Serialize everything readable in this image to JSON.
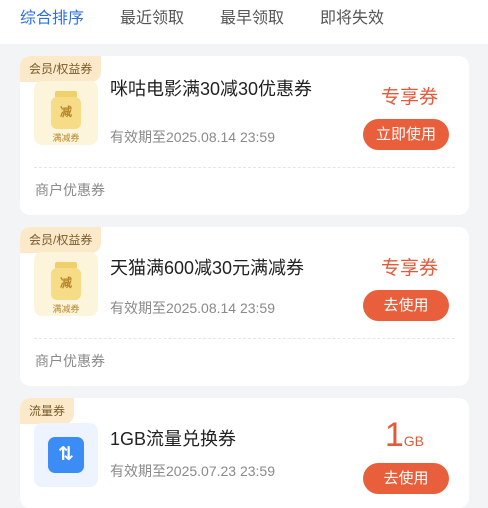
{
  "tabs": [
    {
      "label": "综合排序",
      "active": true
    },
    {
      "label": "最近领取",
      "active": false
    },
    {
      "label": "最早领取",
      "active": false
    },
    {
      "label": "即将失效",
      "active": false
    }
  ],
  "colors": {
    "accent": "#2f6fe0",
    "coupon_red": "#e4593a",
    "button": "#ea5f3b",
    "tag_bg": "#fbe9c9"
  },
  "coupons": [
    {
      "tag": "会员/权益券",
      "thumb_icon": "jar-icon",
      "thumb_symbol": "减",
      "thumb_caption": "满减券",
      "title": "咪咕电影满30减30优惠券",
      "validity": "有效期至2025.08.14 23:59",
      "badge": "专享券",
      "button": "立即使用",
      "merchant": "商户优惠券"
    },
    {
      "tag": "会员/权益券",
      "thumb_icon": "jar-icon",
      "thumb_symbol": "减",
      "thumb_caption": "满减券",
      "title": "天猫满600减30元满减券",
      "validity": "有效期至2025.08.14 23:59",
      "badge": "专享券",
      "button": "去使用",
      "merchant": "商户优惠券"
    },
    {
      "tag": "流量券",
      "thumb_icon": "data-swap-icon",
      "thumb_symbol": "⇅",
      "title": "1GB流量兑换券",
      "validity": "有效期至2025.07.23 23:59",
      "value_number": "1",
      "value_unit": "GB",
      "button": "去使用"
    }
  ]
}
